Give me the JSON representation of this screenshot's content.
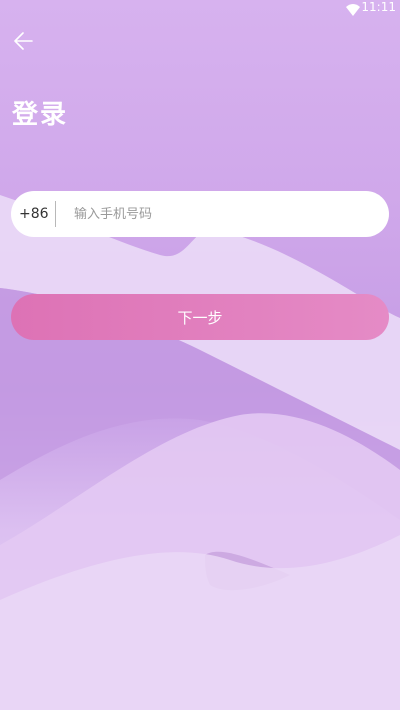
{
  "status_bar": {
    "time": "11:11",
    "wifi_icon": "wifi-icon"
  },
  "header": {
    "back_icon": "arrow-left-icon",
    "title": "登录"
  },
  "phone_form": {
    "country_code": "+86",
    "phone_value": "",
    "phone_placeholder": "输入手机号码"
  },
  "actions": {
    "next_label": "下一步"
  },
  "colors": {
    "background_top": "#d7b2ef",
    "button_start": "#dd72b5",
    "button_end": "#e58bc6",
    "text_white": "#ffffff"
  }
}
